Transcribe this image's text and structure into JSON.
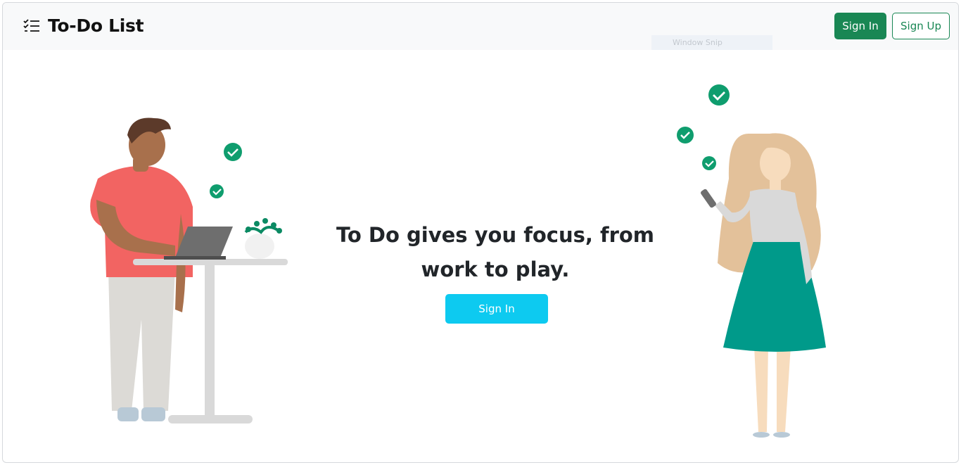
{
  "navbar": {
    "brand_icon": "checklist-icon",
    "brand_title": "To-Do List",
    "sign_in_label": "Sign In",
    "sign_up_label": "Sign Up"
  },
  "overlay": {
    "snip_label": "Window Snip"
  },
  "hero": {
    "heading": "To Do gives you focus, from work to play.",
    "button_label": "Sign In"
  },
  "colors": {
    "primary_green": "#198754",
    "hero_button": "#0dcaf0",
    "check_green": "#0f9d6e",
    "navbar_bg": "#f8f9fa",
    "heading_text": "#212529"
  },
  "icons": [
    "checklist-icon",
    "check-circle-icon",
    "man-with-laptop-illustration",
    "woman-with-phone-illustration"
  ]
}
